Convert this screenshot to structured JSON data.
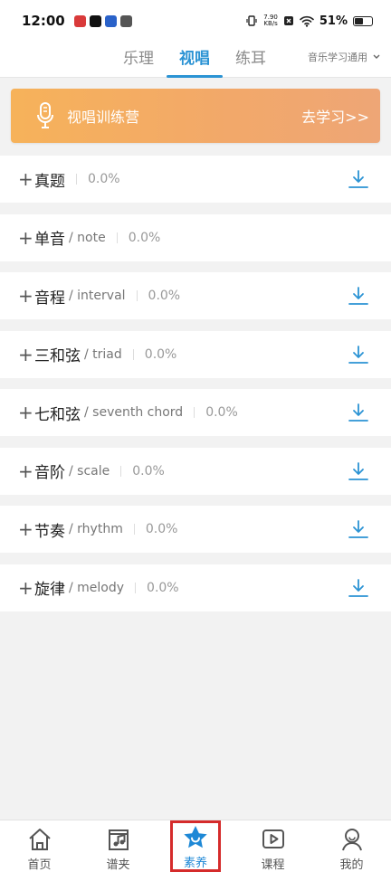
{
  "status": {
    "time": "12:00",
    "net_speed_top": "7.90",
    "net_speed_bottom": "KB/s",
    "battery": "51%",
    "battery_fraction": 0.51
  },
  "tabs": [
    {
      "label": "乐理",
      "active": false
    },
    {
      "label": "视唱",
      "active": true
    },
    {
      "label": "练耳",
      "active": false
    }
  ],
  "scope_label": "音乐学习通用",
  "banner": {
    "title": "视唱训练营",
    "action": "去学习>>"
  },
  "items": [
    {
      "cn": "真题",
      "en": "",
      "pct": "0.0%",
      "download": true
    },
    {
      "cn": "单音",
      "en": "/ note",
      "pct": "0.0%",
      "download": false
    },
    {
      "cn": "音程",
      "en": "/ interval",
      "pct": "0.0%",
      "download": true
    },
    {
      "cn": "三和弦",
      "en": "/ triad",
      "pct": "0.0%",
      "download": true
    },
    {
      "cn": "七和弦",
      "en": "/ seventh chord",
      "pct": "0.0%",
      "download": true
    },
    {
      "cn": "音阶",
      "en": "/ scale",
      "pct": "0.0%",
      "download": true
    },
    {
      "cn": "节奏",
      "en": "/ rhythm",
      "pct": "0.0%",
      "download": true
    },
    {
      "cn": "旋律",
      "en": "/ melody",
      "pct": "0.0%",
      "download": true
    }
  ],
  "bottom_nav": [
    {
      "label": "首页",
      "icon": "home-icon",
      "active": false
    },
    {
      "label": "谱夹",
      "icon": "score-folder-icon",
      "active": false
    },
    {
      "label": "素养",
      "icon": "star-icon",
      "active": true
    },
    {
      "label": "课程",
      "icon": "video-course-icon",
      "active": false
    },
    {
      "label": "我的",
      "icon": "profile-icon",
      "active": false
    }
  ],
  "colors": {
    "accent": "#2b93d4",
    "banner_start": "#f6b25a",
    "banner_end": "#eea676",
    "highlight_box": "#d52b2b"
  }
}
